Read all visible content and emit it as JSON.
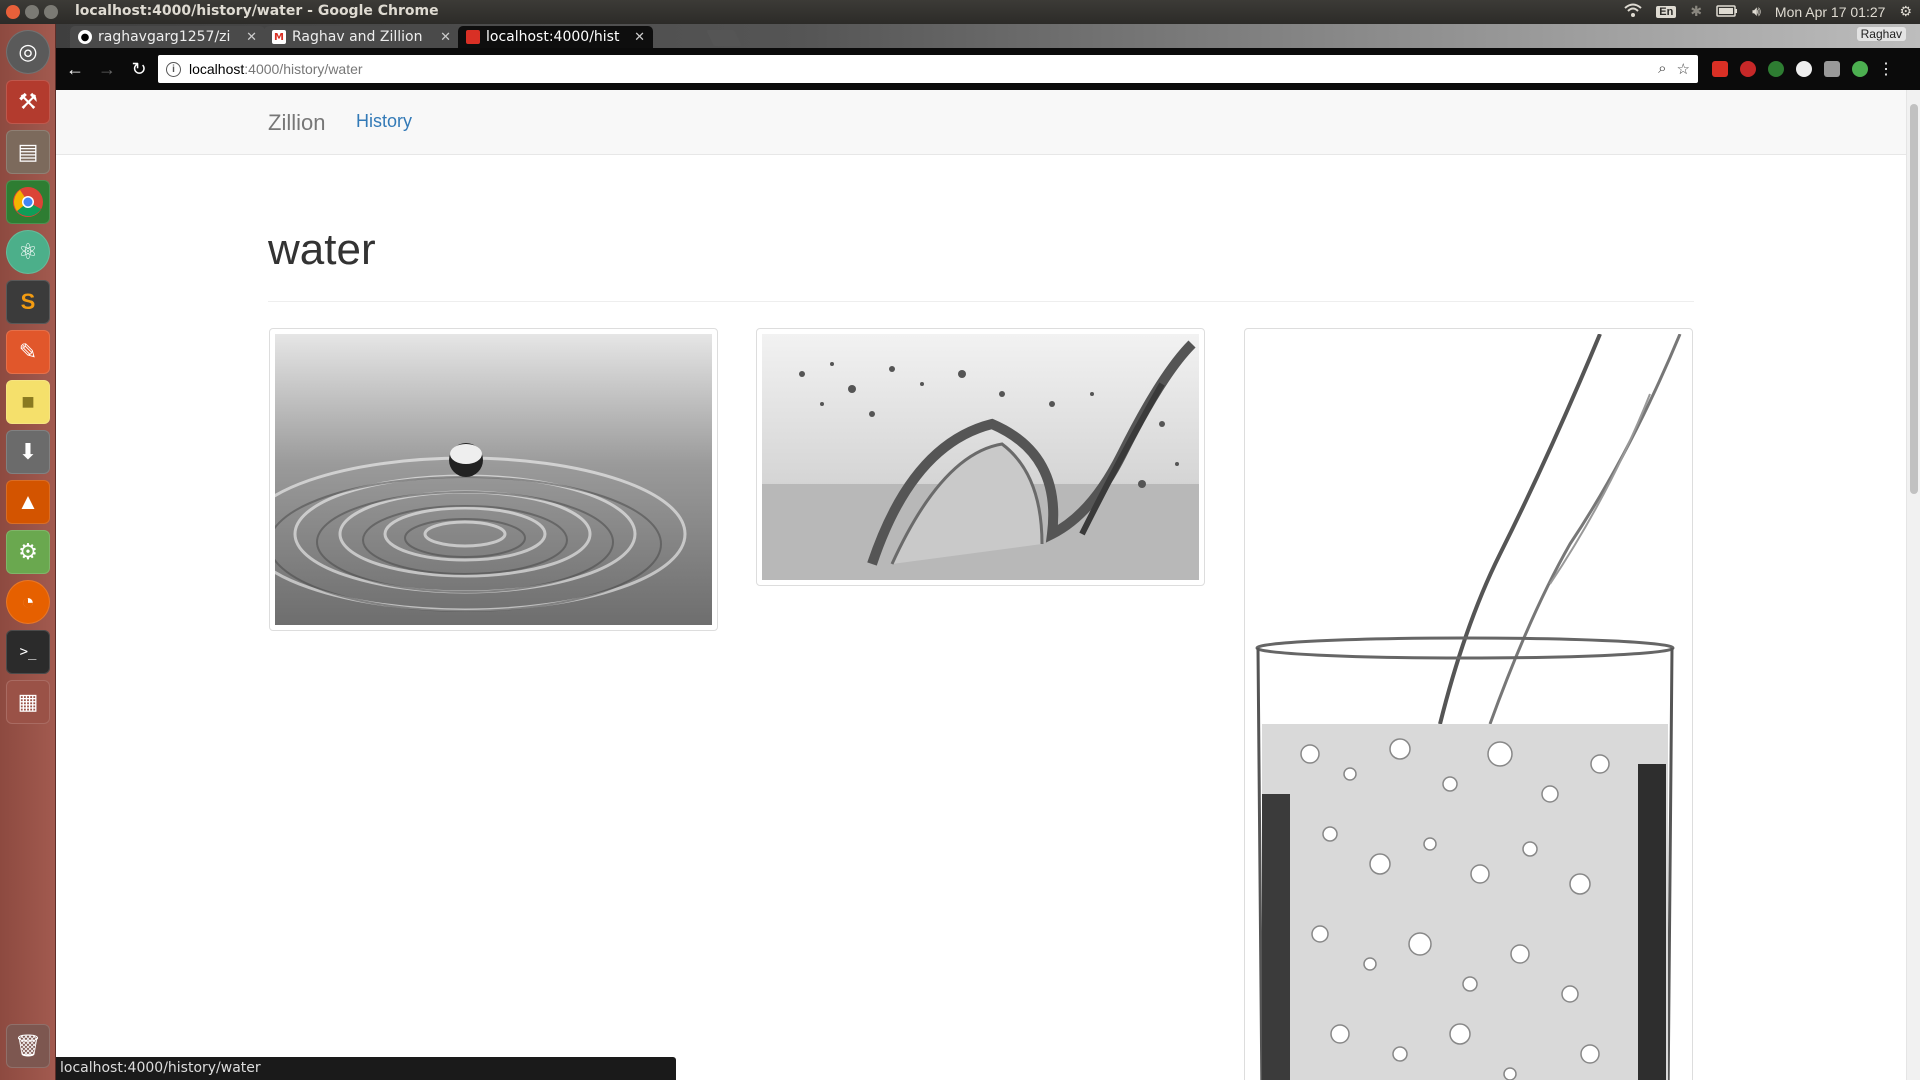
{
  "window": {
    "title": "localhost:4000/history/water - Google Chrome"
  },
  "panel": {
    "keyboard_layout": "En",
    "clock": "Mon Apr 17 01:27",
    "icons": [
      "wifi-icon",
      "keyboard-icon",
      "bluetooth-icon",
      "battery-icon",
      "volume-icon",
      "gear-icon"
    ]
  },
  "launcher": {
    "items": [
      "ubuntu-dash-icon",
      "system-settings-icon",
      "files-icon",
      "chrome-icon",
      "atom-icon",
      "sublime-text-icon",
      "pencil-app-icon",
      "sticky-notes-icon",
      "installer-icon",
      "vlc-icon",
      "tool-icon",
      "firefox-icon",
      "terminal-icon",
      "workspace-icon",
      "trash-icon"
    ]
  },
  "browser": {
    "profile_name": "Raghav",
    "tabs": [
      {
        "label": "raghavgarg1257/zi",
        "icon": "github-icon",
        "active": false
      },
      {
        "label": "Raghav and Zillion",
        "icon": "gmail-icon",
        "active": false
      },
      {
        "label": "localhost:4000/hist",
        "icon": "page-icon",
        "active": true
      }
    ],
    "url_host": "localhost",
    "url_path": ":4000/history/water",
    "status_text": "localhost:4000/history/water"
  },
  "page": {
    "brand": "Zillion",
    "nav_history": "History",
    "title": "water",
    "images": [
      {
        "subject": "water drop ripple"
      },
      {
        "subject": "water splash"
      },
      {
        "subject": "water pouring into glass"
      }
    ]
  },
  "colors": {
    "link": "#337ab7",
    "launcher": "#a25a4f",
    "panel": "#3c3b37"
  }
}
